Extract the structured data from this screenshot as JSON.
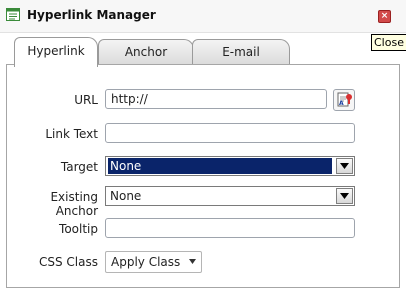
{
  "window": {
    "title": "Hyperlink Manager",
    "close_tooltip": "Close"
  },
  "tabs": [
    {
      "label": "Hyperlink",
      "active": true
    },
    {
      "label": "Anchor",
      "active": false
    },
    {
      "label": "E-mail",
      "active": false
    }
  ],
  "form": {
    "url": {
      "label": "URL",
      "value": "http://"
    },
    "link_text": {
      "label": "Link Text",
      "value": ""
    },
    "target": {
      "label": "Target",
      "value": "None"
    },
    "existing_anchor": {
      "label": "Existing Anchor",
      "value": "None"
    },
    "tooltip": {
      "label": "Tooltip",
      "value": ""
    },
    "css_class": {
      "label": "CSS Class",
      "value": "Apply Class"
    }
  },
  "icons": {
    "title": "hyperlink-manager-icon",
    "close": "close-icon",
    "browse": "document-manager-icon"
  },
  "colors": {
    "selection": "#0a246a",
    "close": "#d24a4a",
    "tooltip_bg": "#ffffe1"
  }
}
